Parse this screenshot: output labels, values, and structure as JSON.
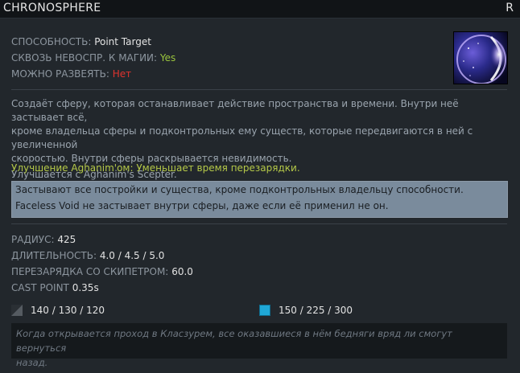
{
  "header": {
    "title": "CHRONOSPHERE",
    "hotkey": "R"
  },
  "meta": {
    "ability_label": "СПОСОБНОСТЬ:",
    "ability_value": "Point Target",
    "spell_immunity_label": "СКВОЗЬ НЕВОСПР. К МАГИИ:",
    "spell_immunity_value": "Yes",
    "dispellable_label": "МОЖНО РАЗВЕЯТЬ:",
    "dispellable_value": "Нет",
    "icon_name": "chronosphere-ability-icon"
  },
  "description": {
    "line1": "Создаёт сферу, которая останавливает действие пространства и времени. Внутри неё застывает всё,",
    "line2": "кроме владельца сферы и подконтрольных ему существ, которые передвигаются в ней с увеличенной",
    "line3": "скоростью. Внутри сферы раскрывается невидимость.",
    "line4": "Улучшается с Aghanim's Scepter."
  },
  "scepter_upgrade": "Улучшение Aghanim'ом: Уменьшает время перезарядки.",
  "notes": [
    "Застывают все постройки и существа, кроме подконтрольных владельцу способности.",
    "Faceless Void не застывает внутри сферы, даже если её применил не он."
  ],
  "stats": {
    "radius_label": "РАДИУС:",
    "radius_value": "425",
    "duration_label": "ДЛИТЕЛЬНОСТЬ:",
    "duration_value": "4.0 / 4.5 / 5.0",
    "scepter_cd_label": "ПЕРЕЗАРЯДКА СО СКИПЕТРОМ:",
    "scepter_cd_value": "60.0",
    "cast_point_label": "CAST POINT",
    "cast_point_value": "0.35s"
  },
  "costs": {
    "cooldown": "140 / 130 / 120",
    "mana": "150 / 225 / 300",
    "cooldown_icon": "cooldown-icon",
    "mana_icon": "mana-icon"
  },
  "lore": {
    "line1": "Когда открывается проход в Класзурем, все оказавшиеся в нём бедняги вряд ли смогут вернуться",
    "line2": "назад."
  },
  "colors": {
    "background": "#22272c",
    "title_bar": "#111417",
    "scepter_text": "#b5c948",
    "yes_value": "#9ac53d",
    "no_value": "#e0332e",
    "note_box": "#7a8b9c",
    "mana": "#1fa7d6"
  }
}
